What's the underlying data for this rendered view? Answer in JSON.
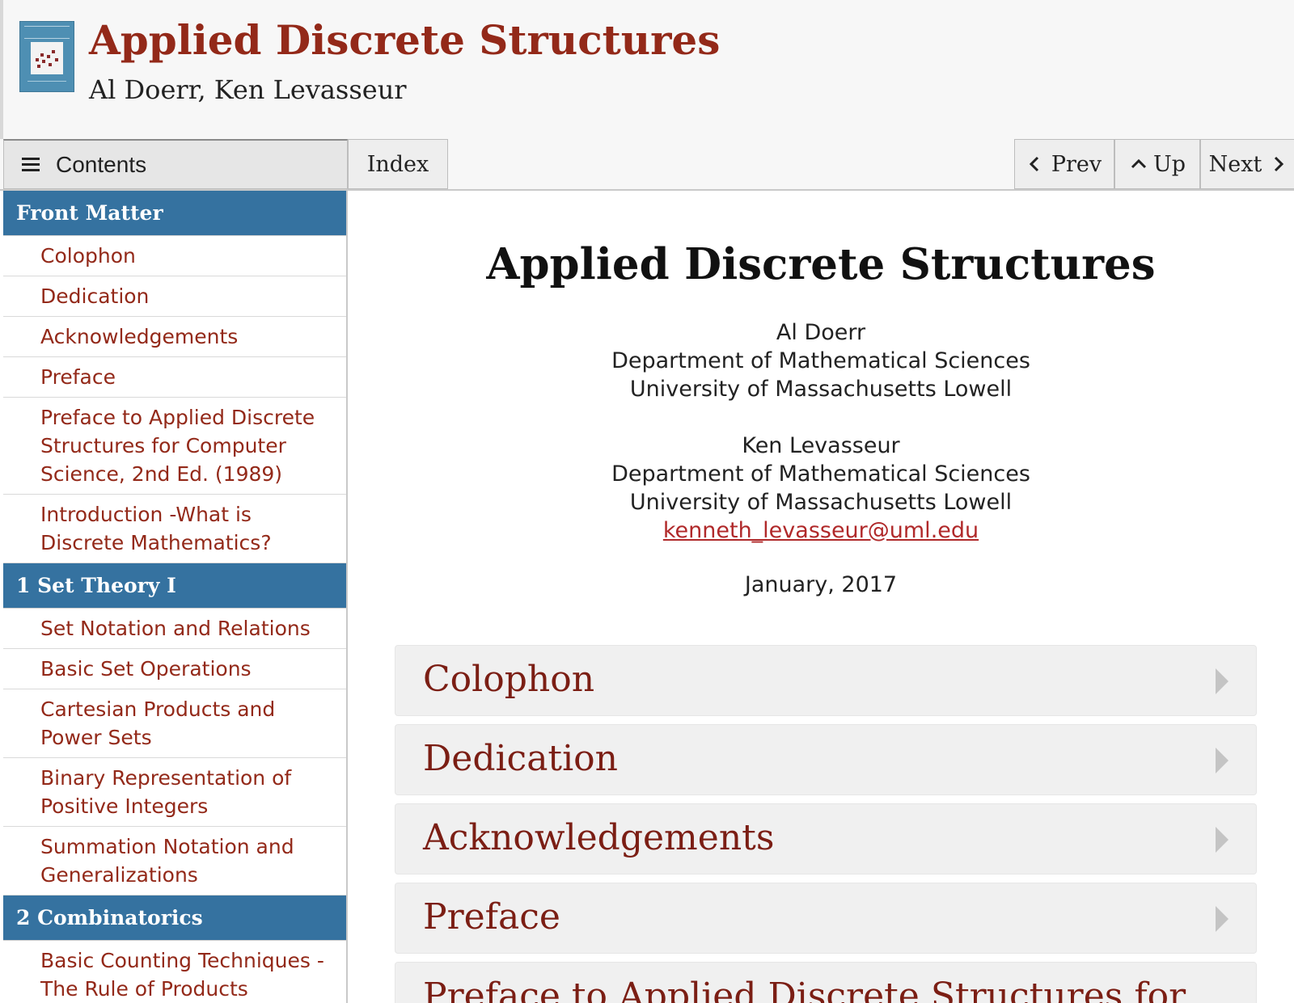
{
  "masthead": {
    "title": "Applied Discrete Structures",
    "authors": "Al Doerr, Ken Levasseur",
    "cover_icon": "book-cover-icon"
  },
  "toolbar": {
    "contents_label": "Contents",
    "index_label": "Index",
    "prev_label": "Prev",
    "up_label": "Up",
    "next_label": "Next"
  },
  "sidebar": {
    "part_front": "Front Matter",
    "front_items": [
      "Colophon",
      "Dedication",
      "Acknowledgements",
      "Preface",
      "Preface to Applied Discrete Structures for Computer Science, 2nd Ed. (1989)",
      "Introduction -What is Discrete Mathematics?"
    ],
    "part_1": "1 Set Theory I",
    "ch1_items": [
      "Set Notation and Relations",
      "Basic Set Operations",
      "Cartesian Products and Power Sets",
      "Binary Representation of Positive Integers",
      "Summation Notation and Generalizations"
    ],
    "part_2": "2 Combinatorics",
    "ch2_items": [
      "Basic Counting Techniques - The Rule of Products"
    ]
  },
  "main": {
    "title": "Applied Discrete Structures",
    "author1": {
      "name": "Al Doerr",
      "dept": "Department of Mathematical Sciences",
      "univ": "University of Massachusetts Lowell"
    },
    "author2": {
      "name": "Ken Levasseur",
      "dept": "Department of Mathematical Sciences",
      "univ": "University of Massachusetts Lowell",
      "email": "kenneth_levasseur@uml.edu"
    },
    "date": "January, 2017",
    "sections": [
      "Colophon",
      "Dedication",
      "Acknowledgements",
      "Preface",
      "Preface to Applied Discrete Structures for"
    ]
  },
  "colors": {
    "accent_red": "#932919",
    "part_blue": "#3572a0"
  }
}
